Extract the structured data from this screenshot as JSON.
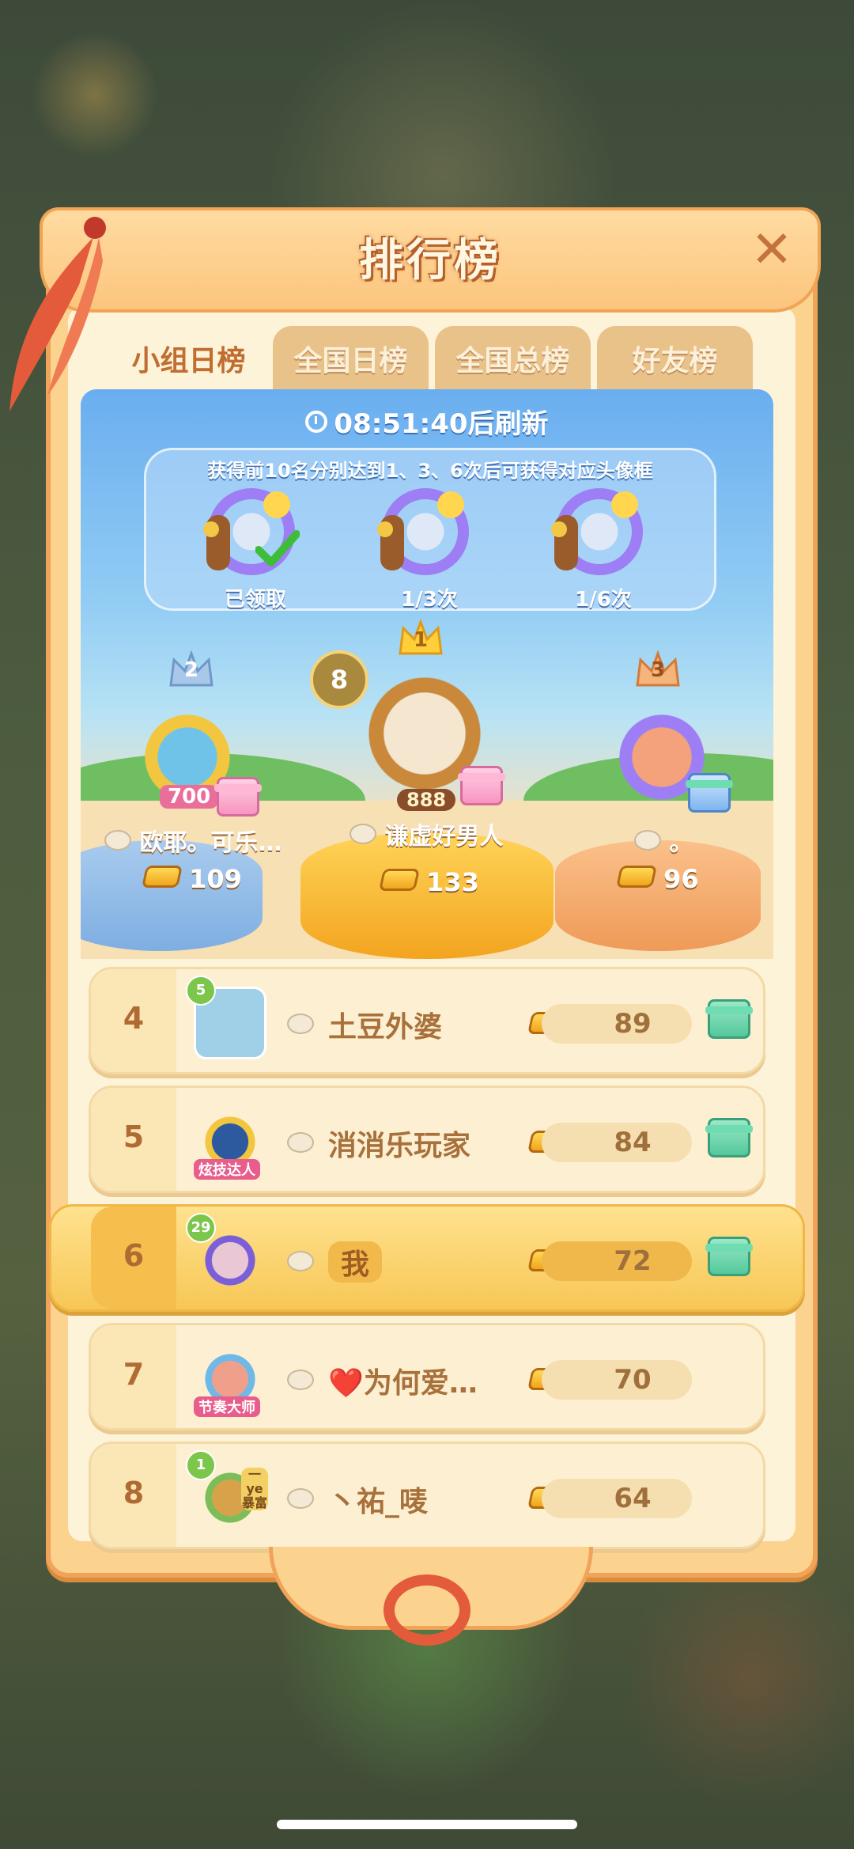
{
  "header": {
    "title": "排行榜",
    "close": "✕"
  },
  "tabs": [
    {
      "label": "小组日榜",
      "active": true
    },
    {
      "label": "全国日榜",
      "active": false
    },
    {
      "label": "全国总榜",
      "active": false
    },
    {
      "label": "好友榜",
      "active": false
    }
  ],
  "banner": {
    "timer": "08:51:40后刷新",
    "reward_desc": "获得前10名分别达到1、3、6次后可获得对应头像框",
    "frames": [
      {
        "label": "已领取"
      },
      {
        "label": "1/3次"
      },
      {
        "label": "1/6次"
      }
    ]
  },
  "podium": [
    {
      "rank": "2",
      "name": "欧耶。可乐…",
      "score": "109",
      "badge": "700"
    },
    {
      "rank": "1",
      "name": "谦虚好男人",
      "score": "133",
      "level": "8",
      "badge": "888"
    },
    {
      "rank": "3",
      "name": "。",
      "score": "96"
    }
  ],
  "list": [
    {
      "rank": "4",
      "name": "土豆外婆",
      "score": "89",
      "level": "5"
    },
    {
      "rank": "5",
      "name": "消消乐玩家",
      "score": "84",
      "avatar_badge": "炫技达人"
    },
    {
      "rank": "6",
      "name": "我",
      "score": "72",
      "level": "29"
    },
    {
      "rank": "7",
      "name": "❤️为何爱…",
      "score": "70",
      "avatar_badge": "节奏大师"
    },
    {
      "rank": "8",
      "name": "丶祐_唛",
      "score": "64",
      "level": "1",
      "avatar_badge": "一ye暴富"
    }
  ],
  "colors": {
    "accent": "#f2a35a",
    "title_stroke": "#b5612b",
    "gift_green": "#54c89b"
  }
}
